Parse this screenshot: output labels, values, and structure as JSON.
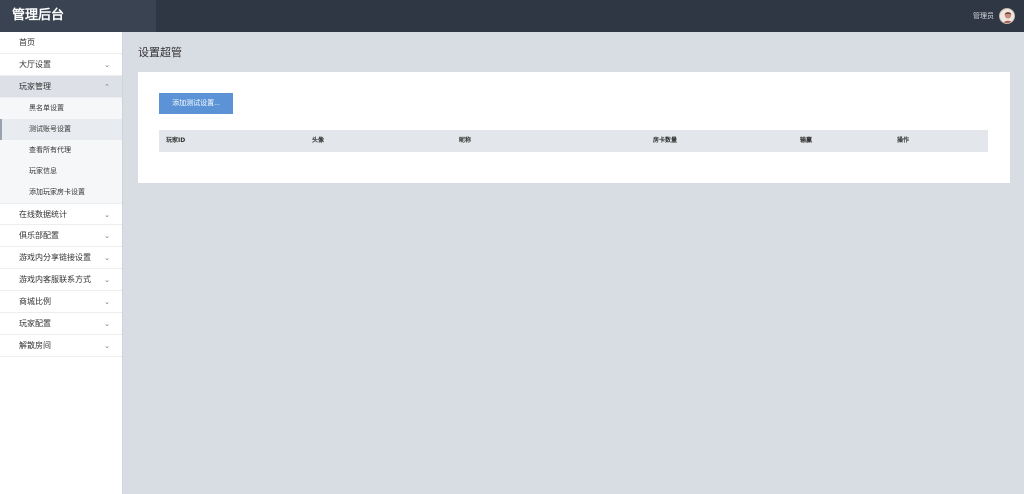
{
  "header": {
    "brand": "管理后台",
    "user_label": "管理员",
    "bg_color": "#2f3744"
  },
  "sidebar": {
    "items": [
      {
        "label": "首页"
      },
      {
        "label": "大厅设置"
      },
      {
        "label": "玩家管理"
      },
      {
        "label": "在线数据统计"
      },
      {
        "label": "俱乐部配置"
      },
      {
        "label": "游戏内分享链接设置"
      },
      {
        "label": "游戏内客服联系方式"
      },
      {
        "label": "商城比例"
      },
      {
        "label": "玩家配置"
      },
      {
        "label": "解散房间"
      }
    ],
    "sub_items": [
      {
        "label": "黑名单设置"
      },
      {
        "label": "测试账号设置"
      },
      {
        "label": "查看所有代理"
      },
      {
        "label": "玩家信息"
      },
      {
        "label": "添加玩家房卡设置"
      }
    ],
    "active_item": "玩家管理",
    "active_sub_item": "测试账号设置"
  },
  "main": {
    "title": "设置超管",
    "add_button": "添加测试设置...",
    "table": {
      "columns": [
        "玩家ID",
        "头像",
        "昵称",
        "房卡数量",
        "输赢",
        "操作"
      ],
      "rows": []
    }
  },
  "colors": {
    "accent": "#5b93d6",
    "page_bg": "#d8dce3"
  }
}
